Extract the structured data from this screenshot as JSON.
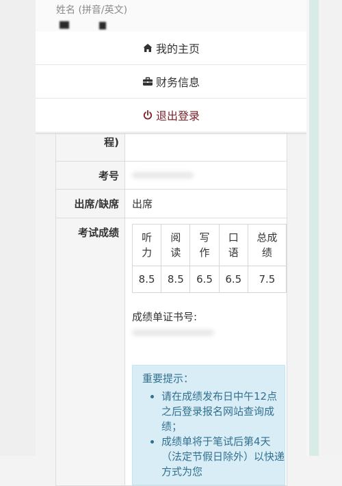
{
  "header": {
    "name_label": "姓名 (拼音/英文)"
  },
  "menu": {
    "items": [
      {
        "label": "我的主页",
        "icon": "home-icon"
      },
      {
        "label": "财务信息",
        "icon": "briefcase-icon"
      },
      {
        "label": "退出登录",
        "icon": "power-icon"
      }
    ],
    "logout_color": "#7a1f29"
  },
  "table": {
    "rows": [
      {
        "label": "程)",
        "value": ""
      },
      {
        "label": "考号",
        "value": ""
      },
      {
        "label": "出席/缺席",
        "value": "出席"
      },
      {
        "label": "考试成绩",
        "value": ""
      }
    ]
  },
  "scores": {
    "headers": [
      "听力",
      "阅读",
      "写作",
      "口语",
      "总成绩"
    ],
    "values": [
      "8.5",
      "8.5",
      "6.5",
      "6.5",
      "7.5"
    ]
  },
  "certificate": {
    "label": "成绩单证书号:"
  },
  "notice": {
    "title": "重要提示：",
    "items": [
      "请在成绩发布日中午12点之后登录报名网站查询成绩；",
      "成绩单将于笔试后第4天（法定节假日除外）以快递方式为您"
    ],
    "bg_color": "#d9edf7",
    "text_color": "#31708f"
  }
}
